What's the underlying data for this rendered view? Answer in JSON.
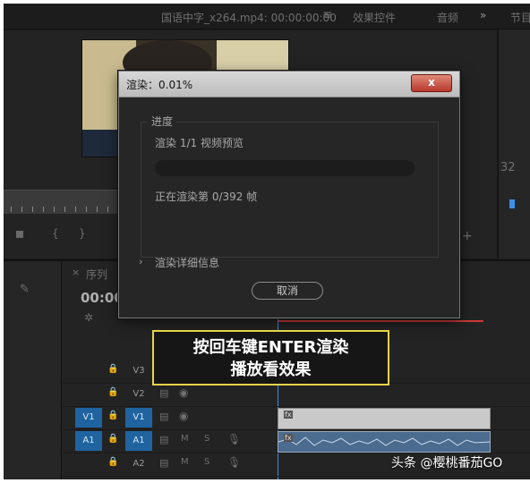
{
  "program_monitor": {
    "source_title": "国语中字_x264.mp4: 00:00:00:00",
    "menu_icon": "≡",
    "tab_effects": "效果控件",
    "tab_audio": "音频",
    "overflow": "»",
    "tab_program": "节目",
    "frame_count_partial": "32"
  },
  "timeline": {
    "sequence_tab": "序列",
    "timecode_partial": "00:00",
    "tracks": [
      {
        "name": "V3",
        "source": "",
        "kind": "video"
      },
      {
        "name": "V2",
        "source": "",
        "kind": "video"
      },
      {
        "name": "V1",
        "source": "V1",
        "kind": "video"
      },
      {
        "name": "A1",
        "source": "A1",
        "kind": "audio"
      },
      {
        "name": "A2",
        "source": "",
        "kind": "audio"
      }
    ],
    "track_m_label": "M",
    "track_s_label": "S",
    "clip_fx_label": "fx"
  },
  "render_dialog": {
    "title": "渲染：0.01%",
    "close_label": "x",
    "group_label": "进度",
    "task_label": "渲染 1/1 视频预览",
    "progress_fraction": 0.0001,
    "frame_status": "正在渲染第 0/392 帧",
    "details_toggle": "›",
    "details_label": "渲染详细信息",
    "cancel_label": "取消"
  },
  "callout": {
    "line1": "按回车键ENTER渲染",
    "line2": "播放看效果"
  },
  "watermark": "头条 @樱桃番茄GO",
  "colors": {
    "accent": "#3d8ee8",
    "callout_border": "#e4d54a",
    "active_track": "#1f64a0",
    "close_button": "#c0392b"
  }
}
